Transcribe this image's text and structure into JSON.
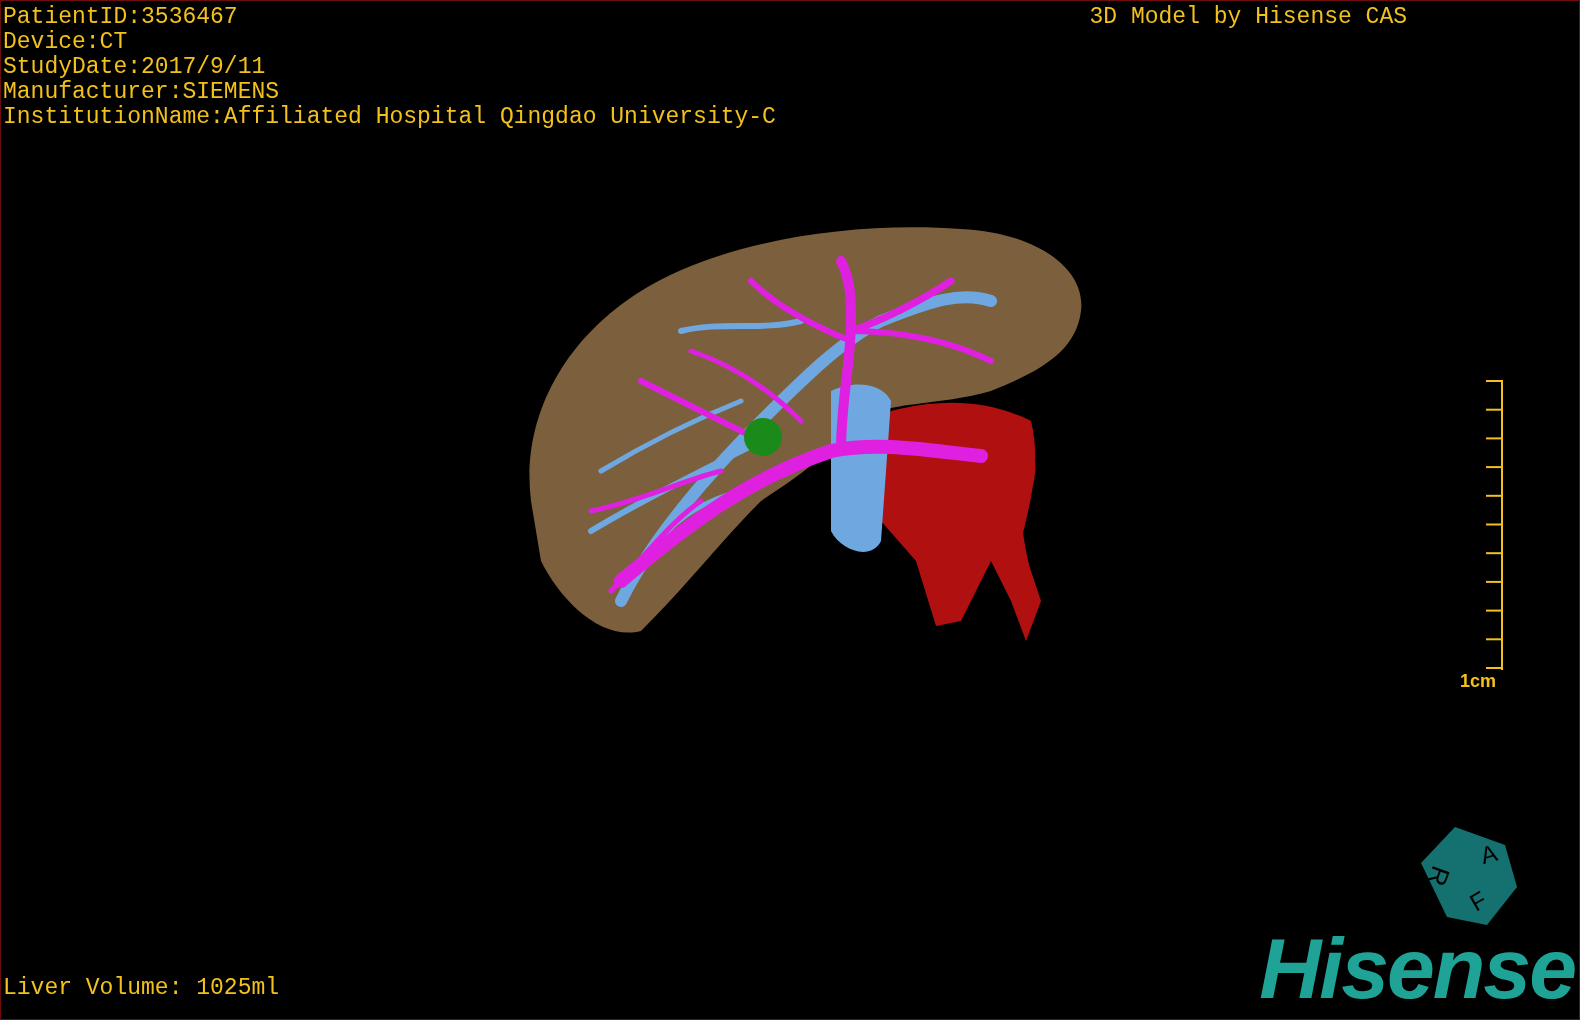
{
  "patient_info": [
    "PatientID:3536467",
    "Device:CT",
    "StudyDate:2017/9/11",
    "Manufacturer:SIEMENS",
    "InstitutionName:Affiliated Hospital Qingdao University-C"
  ],
  "title": "3D Model by Hisense CAS",
  "scale_bar": {
    "label": "1cm"
  },
  "orientation_cube": {
    "labels": [
      "R",
      "A",
      "F"
    ]
  },
  "liver_volume": "Liver Volume: 1025ml",
  "logo": "Hisense"
}
